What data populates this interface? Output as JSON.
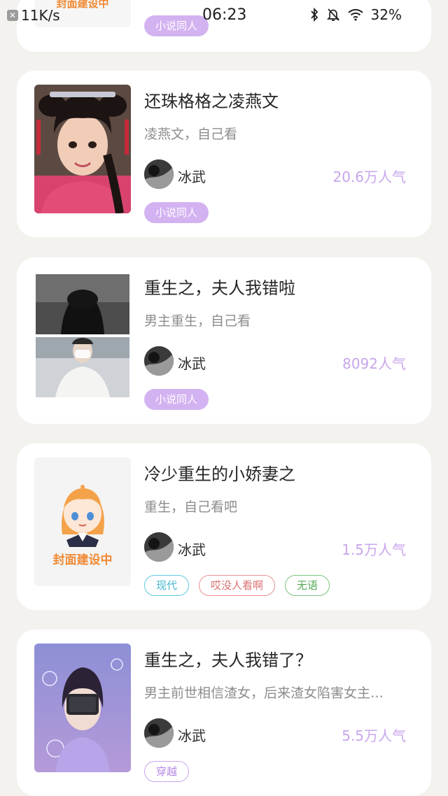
{
  "status_bar": {
    "net_speed": "11K/s",
    "time": "06:23",
    "battery": "32%"
  },
  "placeholder_label": "封面建设中",
  "books": [
    {
      "title": "",
      "desc": "",
      "author": "",
      "popularity": "",
      "tags": [
        "小说同人"
      ]
    },
    {
      "title": "还珠格格之凌燕文",
      "desc": "凌燕文，自己看",
      "author": "冰武",
      "popularity": "20.6万人气",
      "tags": [
        "小说同人"
      ]
    },
    {
      "title": "重生之，夫人我错啦",
      "desc": "男主重生，自己看",
      "author": "冰武",
      "popularity": "8092人气",
      "tags": [
        "小说同人"
      ]
    },
    {
      "title": "冷少重生的小娇妻之",
      "desc": "重生，自己看吧",
      "author": "冰武",
      "popularity": "1.5万人气",
      "tags": [
        "现代",
        "哎没人看啊",
        "无语"
      ]
    },
    {
      "title": "重生之，夫人我错了？",
      "desc": "男主前世相信渣女，后来渣女陷害女主…",
      "author": "冰武",
      "popularity": "5.5万人气",
      "tags": [
        "穿越"
      ]
    }
  ],
  "colors": {
    "background": "#f3f2ef",
    "popularity": "#c8a6ec",
    "tag_fill": "#d3b2f1",
    "tag_cyan": "#5ec9de",
    "tag_red": "#e89191",
    "tag_green": "#7cc37d"
  }
}
